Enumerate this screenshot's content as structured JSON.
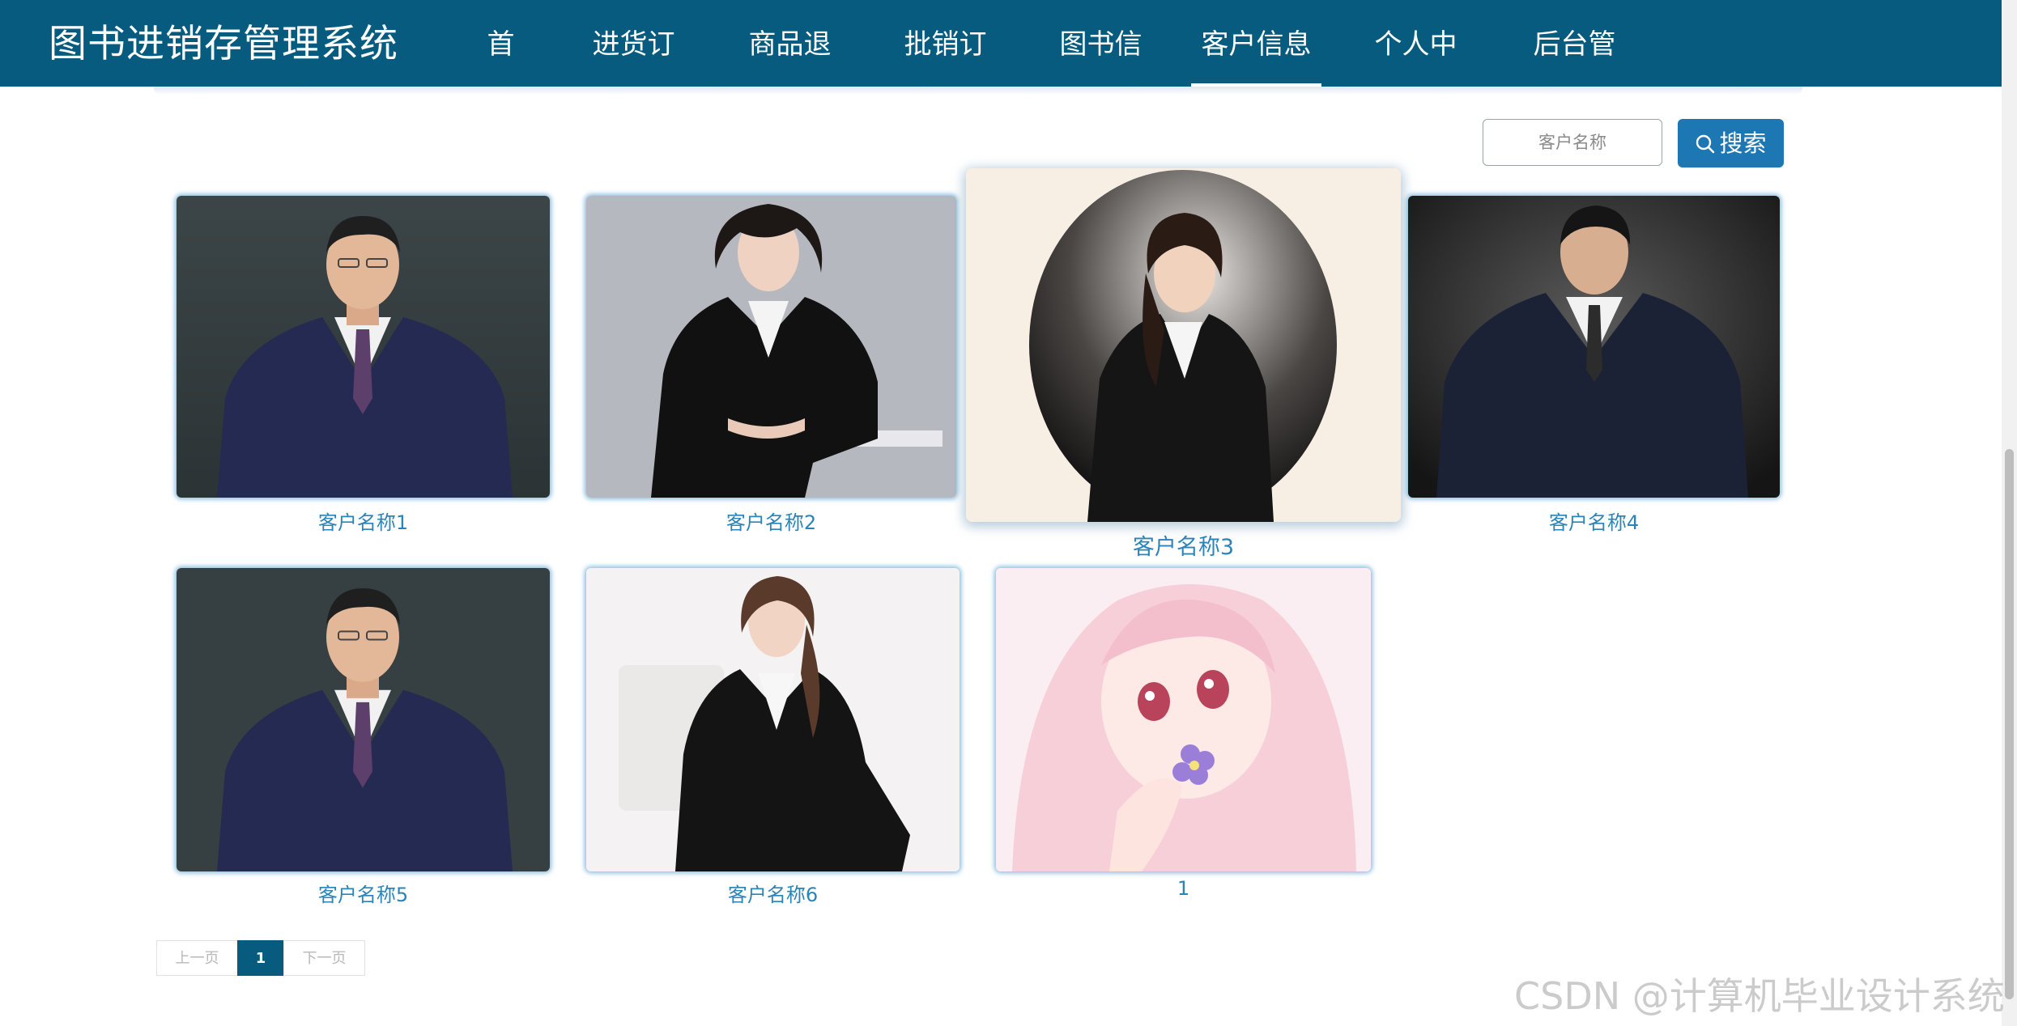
{
  "header": {
    "title": "图书进销存管理系统",
    "nav": [
      {
        "label": "首页"
      },
      {
        "label": "进货订单"
      },
      {
        "label": "商品退货"
      },
      {
        "label": "批销订单"
      },
      {
        "label": "图书信息"
      },
      {
        "label": "客户信息",
        "active": true
      },
      {
        "label": "个人中心"
      },
      {
        "label": "后台管理"
      }
    ],
    "color": "#065b7e"
  },
  "search": {
    "placeholder": "客户名称",
    "button_label": "搜索",
    "button_icon": "search-icon",
    "button_color": "#1d77b3"
  },
  "customers": [
    {
      "name": "客户名称1",
      "photo": "man-in-pinstripe-suit-portrait"
    },
    {
      "name": "客户名称2",
      "photo": "woman-in-black-suit-seated-portrait"
    },
    {
      "name": "客户名称3",
      "photo": "woman-in-black-suit-oval-portrait"
    },
    {
      "name": "客户名称4",
      "photo": "man-in-navy-suit-portrait"
    },
    {
      "name": "客户名称5",
      "photo": "man-in-pinstripe-suit-portrait"
    },
    {
      "name": "客户名称6",
      "photo": "woman-in-black-suit-seated-white-background"
    },
    {
      "name": "1",
      "photo": "anime-girl-pink-hair-illustration"
    }
  ],
  "pagination": {
    "prev_label": "上一页",
    "current_page": "1",
    "next_label": "下一页"
  },
  "watermark": "CSDN @计算机毕业设计系统"
}
